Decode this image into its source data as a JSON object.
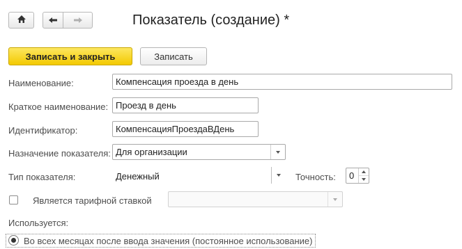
{
  "nav": {
    "home_icon": "home-icon",
    "back_icon": "arrow-left-icon",
    "forward_icon": "arrow-right-icon"
  },
  "window": {
    "title": "Показатель (создание) *"
  },
  "toolbar": {
    "save_close_label": "Записать и закрыть",
    "save_label": "Записать"
  },
  "form": {
    "name": {
      "label": "Наименование:",
      "value": "Компенсация проезда в день"
    },
    "short_name": {
      "label": "Краткое наименование:",
      "value": "Проезд в день"
    },
    "identifier": {
      "label": "Идентификатор:",
      "value": "КомпенсацияПроездаВДень"
    },
    "purpose": {
      "label": "Назначение показателя:",
      "value": "Для организации"
    },
    "type": {
      "label": "Тип показателя:",
      "value": "Денежный"
    },
    "precision": {
      "label": "Точность:",
      "value": "0"
    },
    "tariff": {
      "label": "Является тарифной ставкой",
      "checked": false,
      "value": ""
    },
    "used": {
      "label": "Используется:",
      "option_label": "Во всех месяцах после ввода значения (постоянное использование)",
      "selected": true
    }
  },
  "colors": {
    "primary_button": "#f3c900",
    "primary_border": "#c9a700",
    "input_border": "#a9a9a9",
    "label_text": "#4d4d4d"
  }
}
